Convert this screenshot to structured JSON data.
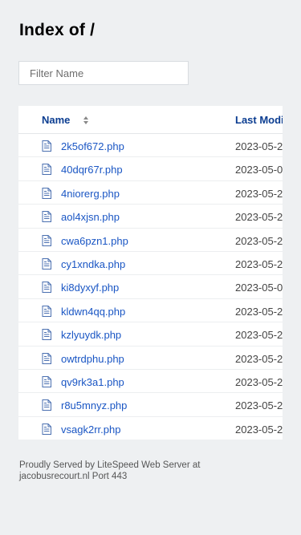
{
  "page": {
    "title": "Index of /"
  },
  "filter": {
    "placeholder": "Filter Name",
    "value": ""
  },
  "table": {
    "columns": {
      "name": "Name",
      "last_modified": "Last Modified"
    },
    "files": [
      {
        "name": "2k5of672.php",
        "date": "2023-05-2"
      },
      {
        "name": "40dqr67r.php",
        "date": "2023-05-0"
      },
      {
        "name": "4niorerg.php",
        "date": "2023-05-2"
      },
      {
        "name": "aol4xjsn.php",
        "date": "2023-05-2"
      },
      {
        "name": "cwa6pzn1.php",
        "date": "2023-05-2"
      },
      {
        "name": "cy1xndka.php",
        "date": "2023-05-2"
      },
      {
        "name": "ki8dyxyf.php",
        "date": "2023-05-0"
      },
      {
        "name": "kldwn4qq.php",
        "date": "2023-05-2"
      },
      {
        "name": "kzlyuydk.php",
        "date": "2023-05-2"
      },
      {
        "name": "owtrdphu.php",
        "date": "2023-05-2"
      },
      {
        "name": "qv9rk3a1.php",
        "date": "2023-05-2"
      },
      {
        "name": "r8u5mnyz.php",
        "date": "2023-05-2"
      },
      {
        "name": "vsagk2rr.php",
        "date": "2023-05-2"
      }
    ]
  },
  "footer": {
    "text": "Proudly Served by LiteSpeed Web Server at jacobusrecourt.nl Port 443"
  },
  "icons": {
    "file": "file-icon",
    "sort": "sort-icon"
  },
  "colors": {
    "background": "#eef0f2",
    "link": "#1a56c4",
    "header_link": "#0b3d91"
  }
}
